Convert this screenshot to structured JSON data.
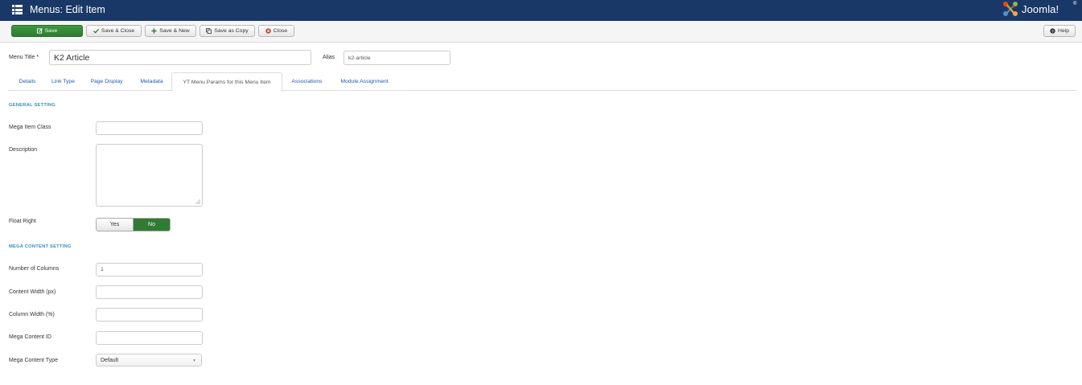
{
  "header": {
    "title": "Menus: Edit Item",
    "logo_text": "Joomla!",
    "logo_reg": "®"
  },
  "toolbar": {
    "save_label": "Save",
    "save_close_label": "Save & Close",
    "save_new_label": "Save & New",
    "save_copy_label": "Save as Copy",
    "close_label": "Close",
    "help_label": "Help"
  },
  "form": {
    "menu_title_label": "Menu Title *",
    "menu_title_value": "K2 Article",
    "alias_label": "Alias",
    "alias_value": "k2-article"
  },
  "tabs": [
    {
      "label": "Details"
    },
    {
      "label": "Link Type"
    },
    {
      "label": "Page Display"
    },
    {
      "label": "Metadata"
    },
    {
      "label": "YT Menu Params for this Menu Item"
    },
    {
      "label": "Associations"
    },
    {
      "label": "Module Assignment"
    }
  ],
  "general": {
    "heading": "GENERAL SETTING",
    "mega_item_class_label": "Mega Item Class",
    "mega_item_class_value": "",
    "description_label": "Description",
    "description_value": "",
    "float_right_label": "Float Right",
    "float_right_yes": "Yes",
    "float_right_no": "No",
    "float_right_selected": "No"
  },
  "mega_content": {
    "heading": "MEGA CONTENT SETTING",
    "num_columns_label": "Number of Columns",
    "num_columns_value": "1",
    "content_width_label": "Content Width (px)",
    "content_width_value": "",
    "column_width_label": "Column Width (%)",
    "column_width_value": "",
    "content_id_label": "Mega Content ID",
    "content_id_value": "",
    "content_type_label": "Mega Content Type",
    "content_type_value": "Default"
  },
  "colors": {
    "header_bg": "#1a3867",
    "save_green": "#2f7c32",
    "tab_link": "#1f5c9e",
    "section_heading": "#3b8bbf"
  },
  "icons": {
    "menu": "menu-icon",
    "save": "edit-icon",
    "save_close": "checkmark-icon",
    "save_new": "plus-icon",
    "save_copy": "copy-icon",
    "close": "cancel-circle-icon",
    "help": "question-circle-icon"
  }
}
